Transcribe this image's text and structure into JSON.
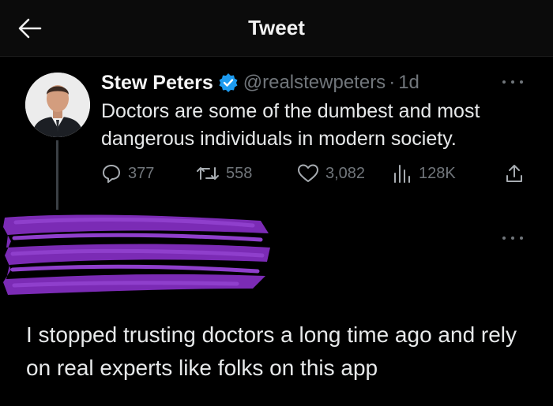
{
  "header": {
    "title": "Tweet"
  },
  "tweet": {
    "author_name": "Stew Peters",
    "handle": "@realstewpeters",
    "separator": "·",
    "time": "1d",
    "text": "Doctors are some of the dumbest and most dangerous individuals in modern society.",
    "stats": {
      "replies": "377",
      "retweets": "558",
      "likes": "3,082",
      "views": "128K"
    }
  },
  "reply": {
    "text": "I stopped trusting doctors a long time ago and rely on real experts like folks on this app"
  },
  "colors": {
    "background": "#000000",
    "text": "#e7e9ea",
    "muted": "#71767b",
    "verified": "#1d9bf0",
    "redaction": "#7b2bb5"
  }
}
